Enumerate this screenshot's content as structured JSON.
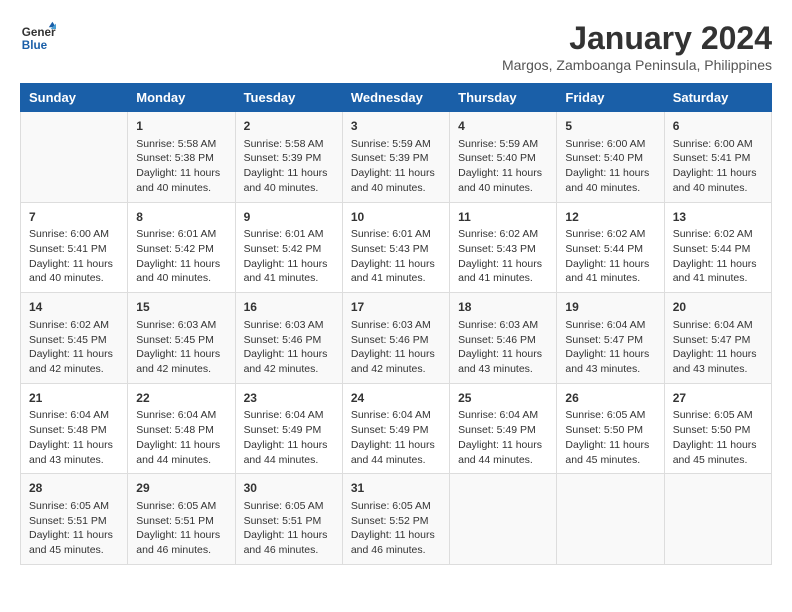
{
  "header": {
    "title": "January 2024",
    "location": "Margos, Zamboanga Peninsula, Philippines",
    "logo_line1": "General",
    "logo_line2": "Blue"
  },
  "weekdays": [
    "Sunday",
    "Monday",
    "Tuesday",
    "Wednesday",
    "Thursday",
    "Friday",
    "Saturday"
  ],
  "weeks": [
    [
      {
        "day": "",
        "info": ""
      },
      {
        "day": "1",
        "info": "Sunrise: 5:58 AM\nSunset: 5:38 PM\nDaylight: 11 hours\nand 40 minutes."
      },
      {
        "day": "2",
        "info": "Sunrise: 5:58 AM\nSunset: 5:39 PM\nDaylight: 11 hours\nand 40 minutes."
      },
      {
        "day": "3",
        "info": "Sunrise: 5:59 AM\nSunset: 5:39 PM\nDaylight: 11 hours\nand 40 minutes."
      },
      {
        "day": "4",
        "info": "Sunrise: 5:59 AM\nSunset: 5:40 PM\nDaylight: 11 hours\nand 40 minutes."
      },
      {
        "day": "5",
        "info": "Sunrise: 6:00 AM\nSunset: 5:40 PM\nDaylight: 11 hours\nand 40 minutes."
      },
      {
        "day": "6",
        "info": "Sunrise: 6:00 AM\nSunset: 5:41 PM\nDaylight: 11 hours\nand 40 minutes."
      }
    ],
    [
      {
        "day": "7",
        "info": "Sunrise: 6:00 AM\nSunset: 5:41 PM\nDaylight: 11 hours\nand 40 minutes."
      },
      {
        "day": "8",
        "info": "Sunrise: 6:01 AM\nSunset: 5:42 PM\nDaylight: 11 hours\nand 40 minutes."
      },
      {
        "day": "9",
        "info": "Sunrise: 6:01 AM\nSunset: 5:42 PM\nDaylight: 11 hours\nand 41 minutes."
      },
      {
        "day": "10",
        "info": "Sunrise: 6:01 AM\nSunset: 5:43 PM\nDaylight: 11 hours\nand 41 minutes."
      },
      {
        "day": "11",
        "info": "Sunrise: 6:02 AM\nSunset: 5:43 PM\nDaylight: 11 hours\nand 41 minutes."
      },
      {
        "day": "12",
        "info": "Sunrise: 6:02 AM\nSunset: 5:44 PM\nDaylight: 11 hours\nand 41 minutes."
      },
      {
        "day": "13",
        "info": "Sunrise: 6:02 AM\nSunset: 5:44 PM\nDaylight: 11 hours\nand 41 minutes."
      }
    ],
    [
      {
        "day": "14",
        "info": "Sunrise: 6:02 AM\nSunset: 5:45 PM\nDaylight: 11 hours\nand 42 minutes."
      },
      {
        "day": "15",
        "info": "Sunrise: 6:03 AM\nSunset: 5:45 PM\nDaylight: 11 hours\nand 42 minutes."
      },
      {
        "day": "16",
        "info": "Sunrise: 6:03 AM\nSunset: 5:46 PM\nDaylight: 11 hours\nand 42 minutes."
      },
      {
        "day": "17",
        "info": "Sunrise: 6:03 AM\nSunset: 5:46 PM\nDaylight: 11 hours\nand 42 minutes."
      },
      {
        "day": "18",
        "info": "Sunrise: 6:03 AM\nSunset: 5:46 PM\nDaylight: 11 hours\nand 43 minutes."
      },
      {
        "day": "19",
        "info": "Sunrise: 6:04 AM\nSunset: 5:47 PM\nDaylight: 11 hours\nand 43 minutes."
      },
      {
        "day": "20",
        "info": "Sunrise: 6:04 AM\nSunset: 5:47 PM\nDaylight: 11 hours\nand 43 minutes."
      }
    ],
    [
      {
        "day": "21",
        "info": "Sunrise: 6:04 AM\nSunset: 5:48 PM\nDaylight: 11 hours\nand 43 minutes."
      },
      {
        "day": "22",
        "info": "Sunrise: 6:04 AM\nSunset: 5:48 PM\nDaylight: 11 hours\nand 44 minutes."
      },
      {
        "day": "23",
        "info": "Sunrise: 6:04 AM\nSunset: 5:49 PM\nDaylight: 11 hours\nand 44 minutes."
      },
      {
        "day": "24",
        "info": "Sunrise: 6:04 AM\nSunset: 5:49 PM\nDaylight: 11 hours\nand 44 minutes."
      },
      {
        "day": "25",
        "info": "Sunrise: 6:04 AM\nSunset: 5:49 PM\nDaylight: 11 hours\nand 44 minutes."
      },
      {
        "day": "26",
        "info": "Sunrise: 6:05 AM\nSunset: 5:50 PM\nDaylight: 11 hours\nand 45 minutes."
      },
      {
        "day": "27",
        "info": "Sunrise: 6:05 AM\nSunset: 5:50 PM\nDaylight: 11 hours\nand 45 minutes."
      }
    ],
    [
      {
        "day": "28",
        "info": "Sunrise: 6:05 AM\nSunset: 5:51 PM\nDaylight: 11 hours\nand 45 minutes."
      },
      {
        "day": "29",
        "info": "Sunrise: 6:05 AM\nSunset: 5:51 PM\nDaylight: 11 hours\nand 46 minutes."
      },
      {
        "day": "30",
        "info": "Sunrise: 6:05 AM\nSunset: 5:51 PM\nDaylight: 11 hours\nand 46 minutes."
      },
      {
        "day": "31",
        "info": "Sunrise: 6:05 AM\nSunset: 5:52 PM\nDaylight: 11 hours\nand 46 minutes."
      },
      {
        "day": "",
        "info": ""
      },
      {
        "day": "",
        "info": ""
      },
      {
        "day": "",
        "info": ""
      }
    ]
  ]
}
